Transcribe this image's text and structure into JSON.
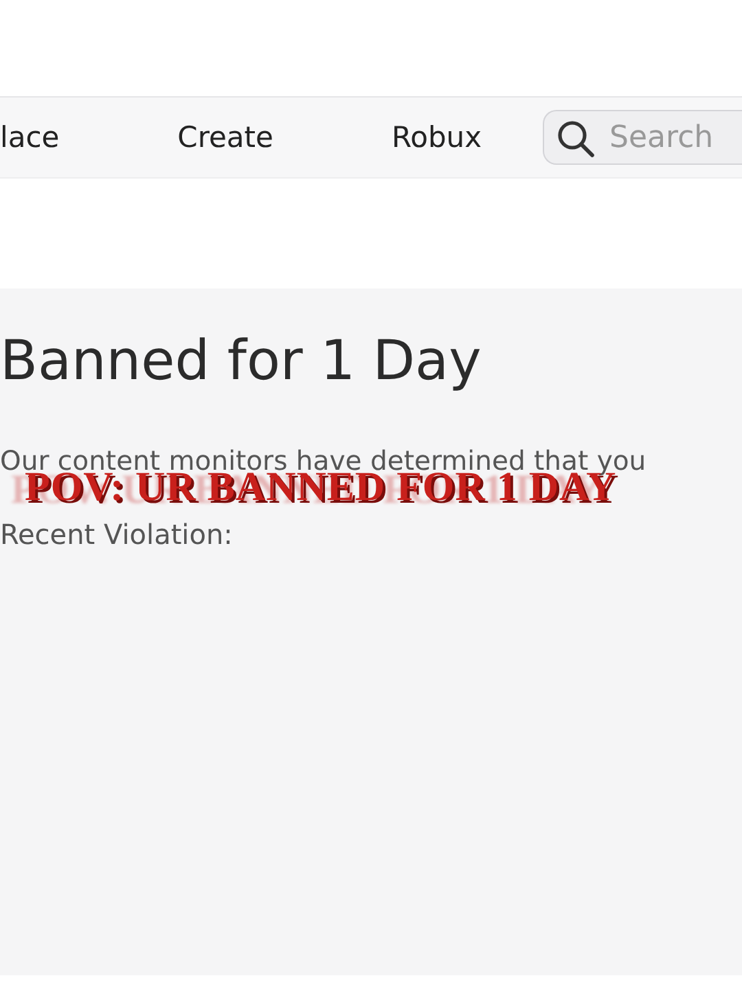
{
  "nav": {
    "items": [
      {
        "label": "lace"
      },
      {
        "label": "Create"
      },
      {
        "label": "Robux"
      }
    ],
    "search": {
      "placeholder": "Search"
    }
  },
  "ban": {
    "title": "Banned for 1 Day",
    "message": "Our content monitors have determined that you",
    "violation_label": "Recent Violation:"
  },
  "caption": "POV: UR BANNED FOR 1 DAY"
}
